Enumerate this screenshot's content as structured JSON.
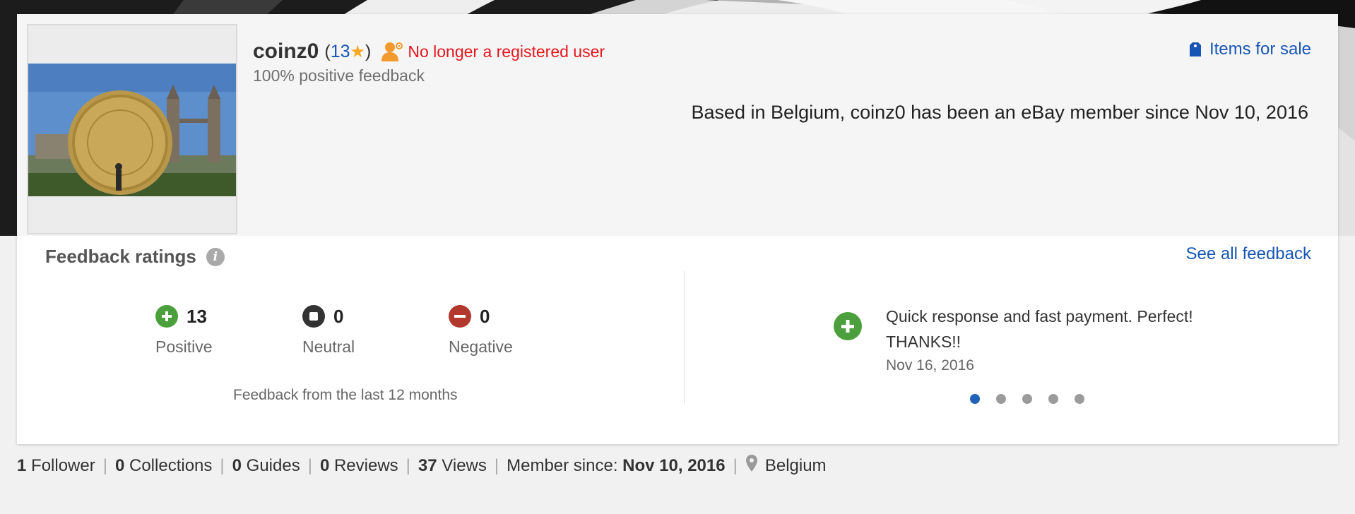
{
  "profile": {
    "username": "coinz0",
    "score_open": "(",
    "score": "13",
    "score_star": "★",
    "score_close": ")",
    "status": "No longer a registered user",
    "positive_feedback": "100% positive feedback",
    "items_for_sale": "Items for sale",
    "member_text": "Based in Belgium, coinz0 has been an eBay member since Nov 10, 2016"
  },
  "feedback": {
    "title": "Feedback ratings",
    "info_glyph": "i",
    "see_all": "See all feedback",
    "ratings": [
      {
        "count": "13",
        "label": "Positive",
        "color": "#4b9f3c"
      },
      {
        "count": "0",
        "label": "Neutral",
        "color": "#333333"
      },
      {
        "count": "0",
        "label": "Negative",
        "color": "#b2372c"
      }
    ],
    "period": "Feedback from the last 12 months",
    "recent": {
      "text": "Quick response and fast payment. Perfect! THANKS!!",
      "date": "Nov 16, 2016"
    },
    "carousel": {
      "total": 5,
      "active": 1
    }
  },
  "stats": {
    "followers_count": "1",
    "followers_label": "Follower",
    "collections_count": "0",
    "collections_label": "Collections",
    "guides_count": "0",
    "guides_label": "Guides",
    "reviews_count": "0",
    "reviews_label": "Reviews",
    "views_count": "37",
    "views_label": "Views",
    "member_since_label": "Member since:",
    "member_since_date": "Nov 10, 2016",
    "location": "Belgium"
  },
  "colors": {
    "link": "#1856b5",
    "status": "#e5161e",
    "star": "#f5a623"
  }
}
